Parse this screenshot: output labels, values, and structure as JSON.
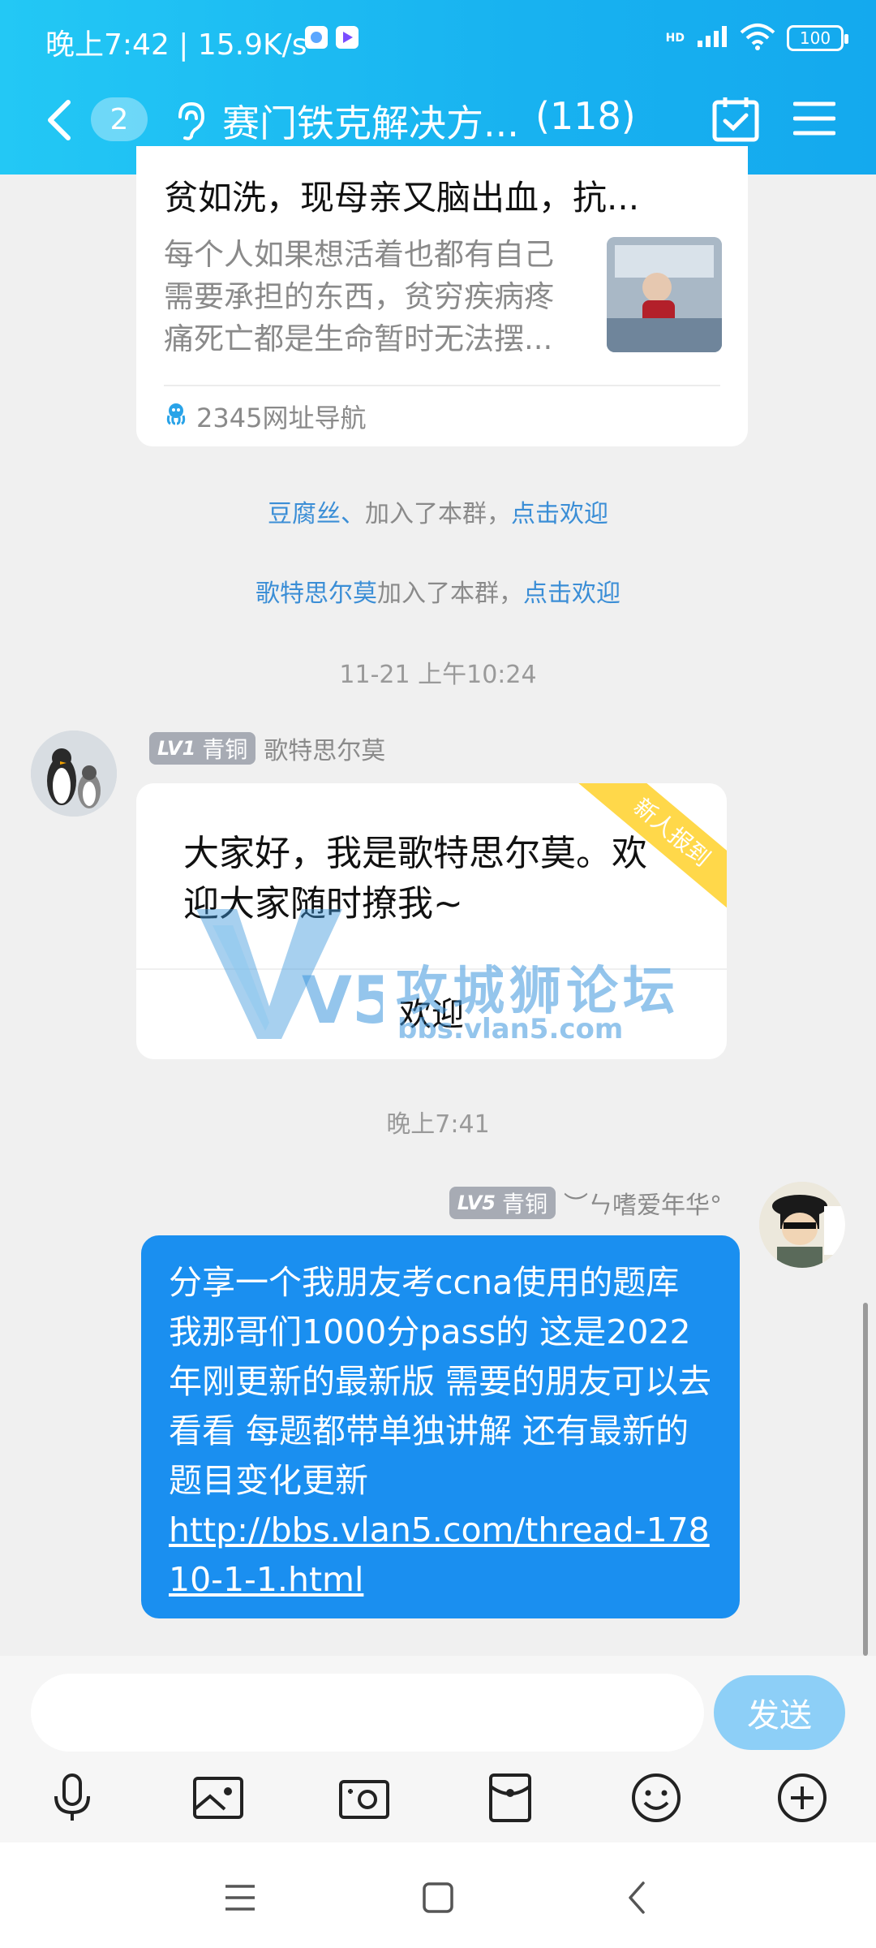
{
  "status_bar": {
    "time_speed": "晚上7:42 | 15.9K/s",
    "network": "HD",
    "battery": "100"
  },
  "header": {
    "unread_count": "2",
    "title": "赛门铁克解决方...",
    "member_count": "(118)"
  },
  "share_card": {
    "title": "贫如洗，现母亲又脑出血，抗...",
    "description": "每个人如果想活着也都有自己需要承担的东西，贫穷疾病疼痛死亡都是生命暂时无法摆...",
    "source": "2345网址导航"
  },
  "system_messages": [
    {
      "name": "豆腐丝、",
      "text": "加入了本群，",
      "link": "点击欢迎"
    },
    {
      "name": "歌特思尔莫",
      "text": "加入了本群，",
      "link": "点击欢迎"
    }
  ],
  "timestamps": [
    "11-21 上午10:24",
    "晚上7:41"
  ],
  "welcome_message": {
    "level": "LV1",
    "rank": "青铜",
    "sender": "歌特思尔莫",
    "text": "大家好，我是歌特思尔莫。欢迎大家随时撩我~",
    "ribbon": "新人报到",
    "button": "欢迎"
  },
  "watermark": {
    "title": "攻城狮论坛",
    "url": "bbs.vlan5.com",
    "logo_text": "V5"
  },
  "my_message": {
    "level": "LV5",
    "rank": "青铜",
    "sender": "︶ㄣ嗜爱年华°",
    "text": "分享一个我朋友考ccna使用的题库 我那哥们1000分pass的 这是2022年刚更新的最新版 需要的朋友可以去看看 每题都带单独讲解 还有最新的题目变化更新",
    "link": "http://bbs.vlan5.com/thread-17810-1-1.html"
  },
  "input": {
    "placeholder": "",
    "send_label": "发送"
  },
  "toolbar_icons": [
    "microphone-icon",
    "image-icon",
    "camera-icon",
    "red-packet-icon",
    "emoji-icon",
    "plus-icon"
  ],
  "colors": {
    "header": "#18b2f0",
    "my_bubble": "#1a8ff0",
    "link_blue": "#3b8ed6",
    "send_button": "#8dcff7",
    "ribbon": "#ffd84a"
  }
}
